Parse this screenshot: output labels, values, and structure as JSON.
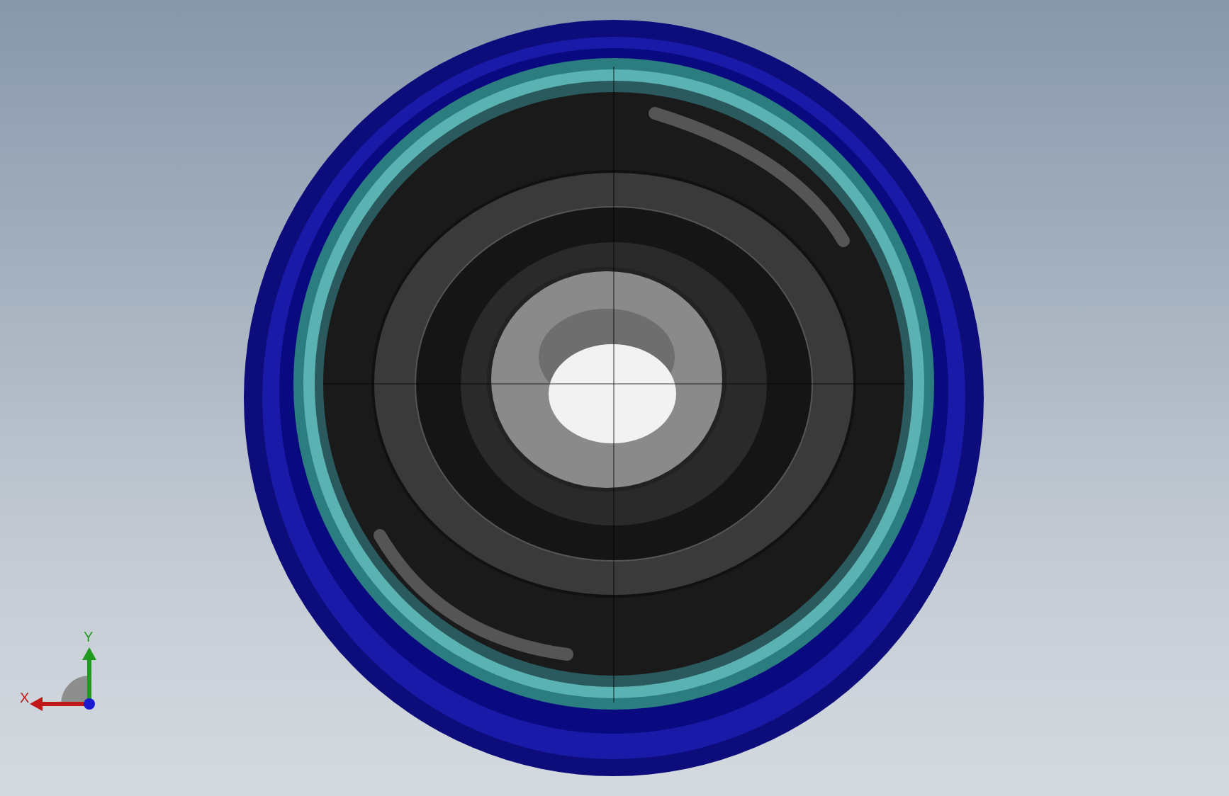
{
  "triad": {
    "axes": [
      {
        "label": "Y",
        "color": "#1f9a1f"
      },
      {
        "label": "X",
        "color": "#c01818"
      }
    ]
  }
}
